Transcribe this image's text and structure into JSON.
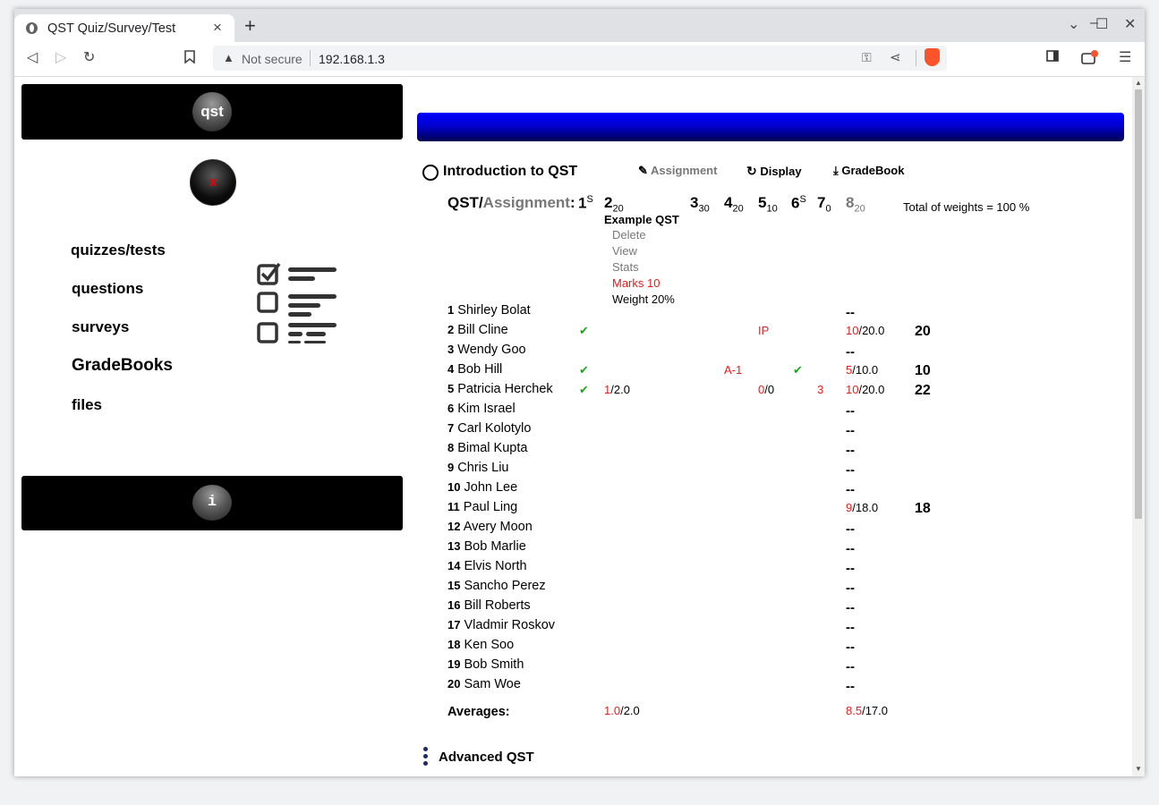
{
  "browser": {
    "tab_title": "QST Quiz/Survey/Test",
    "tab_close": "×",
    "new_tab": "+",
    "security_text": "Not secure",
    "url": "192.168.1.3",
    "window_controls": [
      "⌄",
      "–",
      "☐",
      "✕"
    ]
  },
  "sidebar": {
    "logo_label": "qst",
    "close_label": "x",
    "nav": [
      "quizzes/tests",
      "questions",
      "surveys",
      "GradeBooks",
      "files"
    ],
    "info_label": "i"
  },
  "main": {
    "course_title": "Introduction to QST",
    "tools": {
      "assignment": "Assignment",
      "display": "Display",
      "gradebook": "GradeBook"
    },
    "header": {
      "prefix": "QST/",
      "assignment_word": "Assignment",
      "colon": ":"
    },
    "columns": [
      {
        "num": "1",
        "sup": "S"
      },
      {
        "num": "2",
        "sub": "20"
      },
      {
        "num": "3",
        "sub": "30"
      },
      {
        "num": "4",
        "sub": "20"
      },
      {
        "num": "5",
        "sub": "10"
      },
      {
        "num": "6",
        "sup": "S"
      },
      {
        "num": "7",
        "sub": "0"
      },
      {
        "num": "8",
        "sub": "20"
      }
    ],
    "weights_total": "Total of weights = 100 %",
    "qst_menu": {
      "title": "Example QST",
      "delete": "Delete",
      "view": "View",
      "stats": "Stats",
      "marks": "Marks 10",
      "weight": "Weight 20%"
    },
    "students": [
      {
        "n": "1",
        "name": "Shirley Bolat",
        "g": "--"
      },
      {
        "n": "2",
        "name": "Bill Cline",
        "c1": "✔",
        "c5": "IP",
        "g": "10",
        "gd": "/20.0",
        "total": "20"
      },
      {
        "n": "3",
        "name": "Wendy Goo",
        "g": "--"
      },
      {
        "n": "4",
        "name": "Bob Hill",
        "c1": "✔",
        "c4": "A-1",
        "c6": "✔",
        "g": "5",
        "gd": "/10.0",
        "total": "10"
      },
      {
        "n": "5",
        "name": "Patricia Herchek",
        "c1": "✔",
        "c2": "1",
        "c2d": "/2.0",
        "c5": "0",
        "c5d": "/0",
        "c7": "3",
        "g": "10",
        "gd": "/20.0",
        "total": "22"
      },
      {
        "n": "6",
        "name": "Kim Israel",
        "g": "--"
      },
      {
        "n": "7",
        "name": "Carl Kolotylo",
        "g": "--"
      },
      {
        "n": "8",
        "name": "Bimal Kupta",
        "g": "--"
      },
      {
        "n": "9",
        "name": "Chris Liu",
        "g": "--"
      },
      {
        "n": "10",
        "name": "John Lee",
        "g": "--"
      },
      {
        "n": "11",
        "name": "Paul Ling",
        "g": "9",
        "gd": "/18.0",
        "total": "18"
      },
      {
        "n": "12",
        "name": "Avery Moon",
        "g": "--"
      },
      {
        "n": "13",
        "name": "Bob Marlie",
        "g": "--"
      },
      {
        "n": "14",
        "name": "Elvis North",
        "g": "--"
      },
      {
        "n": "15",
        "name": "Sancho Perez",
        "g": "--"
      },
      {
        "n": "16",
        "name": "Bill Roberts",
        "g": "--"
      },
      {
        "n": "17",
        "name": "Vladmir Roskov",
        "g": "--"
      },
      {
        "n": "18",
        "name": "Ken Soo",
        "g": "--"
      },
      {
        "n": "19",
        "name": "Bob Smith",
        "g": "--"
      },
      {
        "n": "20",
        "name": "Sam Woe",
        "g": "--"
      }
    ],
    "averages": {
      "label": "Averages:",
      "c2": "1.0",
      "c2d": "/2.0",
      "g": "8.5",
      "gd": "/17.0"
    },
    "advanced": "Advanced QST"
  }
}
